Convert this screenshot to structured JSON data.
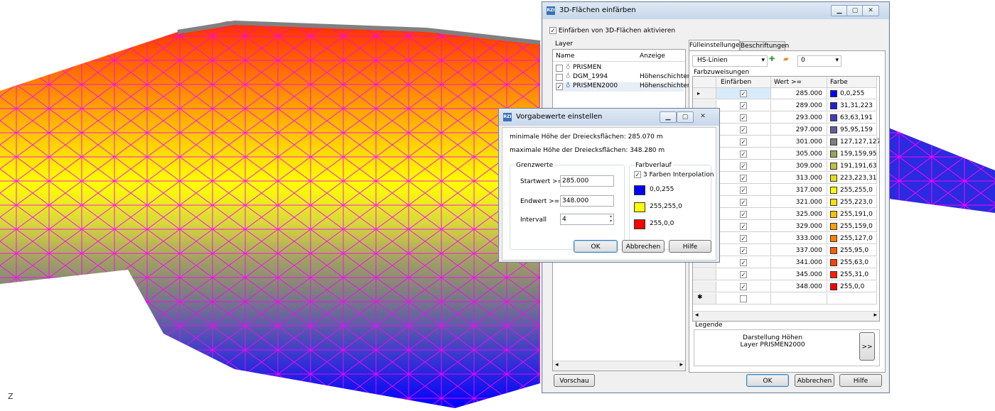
{
  "colors": {
    "accent": "#3c7fb1",
    "wire": "#ff00ff"
  },
  "viewport": {
    "axis_label": "Z"
  },
  "main_dialog": {
    "title": "3D-Flächen einfärben",
    "activate_label": "Einfärben von 3D-Flächen aktivieren",
    "layer_group": "Layer",
    "layer_cols": {
      "name": "Name",
      "anzeige": "Anzeige"
    },
    "layers": [
      {
        "name": "PRISMEN",
        "anzeige": "",
        "checked": false
      },
      {
        "name": "DGM_1994",
        "anzeige": "Höhenschichten",
        "checked": false
      },
      {
        "name": "PRISMEN2000",
        "anzeige": "Höhenschichten",
        "checked": true
      }
    ],
    "tabs": [
      "Fülleinstellungen",
      "Beschriftungen"
    ],
    "mode_select": "HS-Linien",
    "number_select": "0",
    "farbzuweisungen": "Farbzuweisungen",
    "grid_cols": {
      "einfaerben": "Einfärben",
      "wert": "Wert >=",
      "farbe": "Farbe"
    },
    "rows": [
      {
        "wert": "285.000",
        "farbe": "0,0,255",
        "hex": "#0000ff"
      },
      {
        "wert": "289.000",
        "farbe": "31,31,223",
        "hex": "#1f1fdf"
      },
      {
        "wert": "293.000",
        "farbe": "63,63,191",
        "hex": "#3f3fbf"
      },
      {
        "wert": "297.000",
        "farbe": "95,95,159",
        "hex": "#5f5f9f"
      },
      {
        "wert": "301.000",
        "farbe": "127,127,127",
        "hex": "#7f7f7f"
      },
      {
        "wert": "305.000",
        "farbe": "159,159,95",
        "hex": "#9f9f5f"
      },
      {
        "wert": "309.000",
        "farbe": "191,191,63",
        "hex": "#bfbf3f"
      },
      {
        "wert": "313.000",
        "farbe": "223,223,31",
        "hex": "#dfdf1f"
      },
      {
        "wert": "317.000",
        "farbe": "255,255,0",
        "hex": "#ffff00"
      },
      {
        "wert": "321.000",
        "farbe": "255,223,0",
        "hex": "#ffdf00"
      },
      {
        "wert": "325.000",
        "farbe": "255,191,0",
        "hex": "#ffbf00"
      },
      {
        "wert": "329.000",
        "farbe": "255,159,0",
        "hex": "#ff9f00"
      },
      {
        "wert": "333.000",
        "farbe": "255,127,0",
        "hex": "#ff7f00"
      },
      {
        "wert": "337.000",
        "farbe": "255,95,0",
        "hex": "#ff5f00"
      },
      {
        "wert": "341.000",
        "farbe": "255,63,0",
        "hex": "#ff3f00"
      },
      {
        "wert": "345.000",
        "farbe": "255,31,0",
        "hex": "#ff1f00"
      },
      {
        "wert": "348.000",
        "farbe": "255,0,0",
        "hex": "#ff0000"
      }
    ],
    "legende_group": "Legende",
    "legende_line1": "Darstellung Höhen",
    "legende_line2": "Layer PRISMEN2000",
    "legende_btn": ">>",
    "vorschau": "Vorschau",
    "ok": "OK",
    "abbrechen": "Abbrechen",
    "hilfe": "Hilfe"
  },
  "vorgabe_dialog": {
    "title": "Vorgabewerte einstellen",
    "min_text": "minimale Höhe der Dreiecksflächen: 285.070 m",
    "max_text": "maximale Höhe der Dreiecksflächen: 348.280 m",
    "grenzwerte": "Grenzwerte",
    "startwert_label": "Startwert >=",
    "startwert": "285.000",
    "endwert_label": "Endwert >=",
    "endwert": "348.000",
    "intervall_label": "Intervall",
    "intervall": "4",
    "farbverlauf": "Farbverlauf",
    "interpolation": "3 Farben Interpolation",
    "colors": [
      {
        "text": "0,0,255",
        "hex": "#0000ff"
      },
      {
        "text": "255,255,0",
        "hex": "#ffff00"
      },
      {
        "text": "255,0,0",
        "hex": "#ff0000"
      }
    ],
    "ok": "OK",
    "abbrechen": "Abbrechen",
    "hilfe": "Hilfe"
  }
}
